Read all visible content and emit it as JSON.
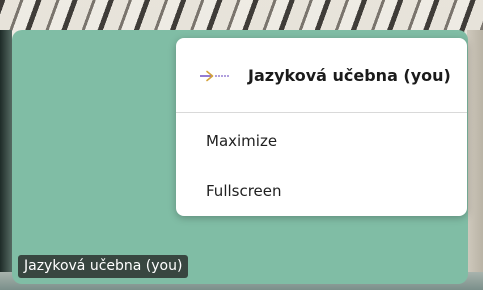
{
  "participant": {
    "name_label": "Jazyková učebna (you)"
  },
  "menu": {
    "title": "Jazyková učebna (you)",
    "items": [
      {
        "label": "Maximize"
      },
      {
        "label": "Fullscreen"
      }
    ],
    "header_icon": "self-view-arrow-icon"
  },
  "colors": {
    "tile_bg": "#80bda5",
    "accent": "#7a5cc7",
    "menu_bg": "#ffffff"
  }
}
